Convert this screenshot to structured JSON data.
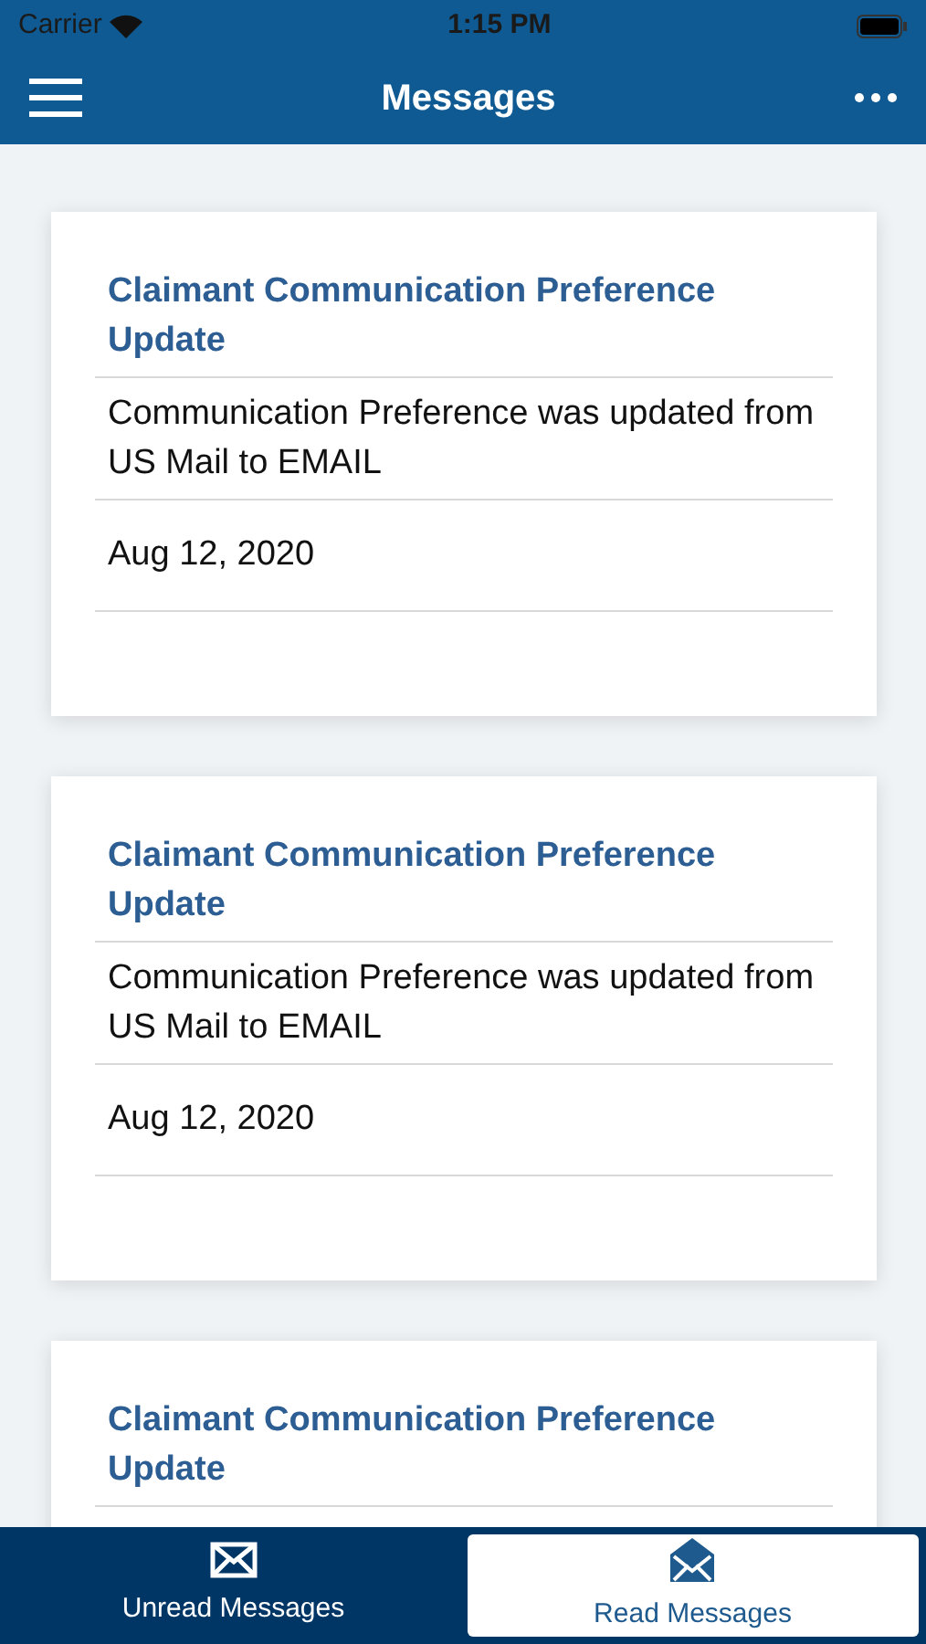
{
  "status_bar": {
    "carrier": "Carrier",
    "time": "1:15 PM"
  },
  "nav": {
    "title": "Messages"
  },
  "messages": [
    {
      "title": "Claimant Communication Preference Update",
      "body": "Communication Preference was updated from US Mail to EMAIL",
      "date": "Aug 12, 2020"
    },
    {
      "title": "Claimant Communication Preference Update",
      "body": "Communication Preference was updated from US Mail to EMAIL",
      "date": "Aug 12, 2020"
    },
    {
      "title": "Claimant Communication Preference Update"
    }
  ],
  "tabs": [
    {
      "label": "Unread Messages",
      "kind": "closed",
      "selected": false
    },
    {
      "label": "Read Messages",
      "kind": "open",
      "selected": true
    }
  ]
}
